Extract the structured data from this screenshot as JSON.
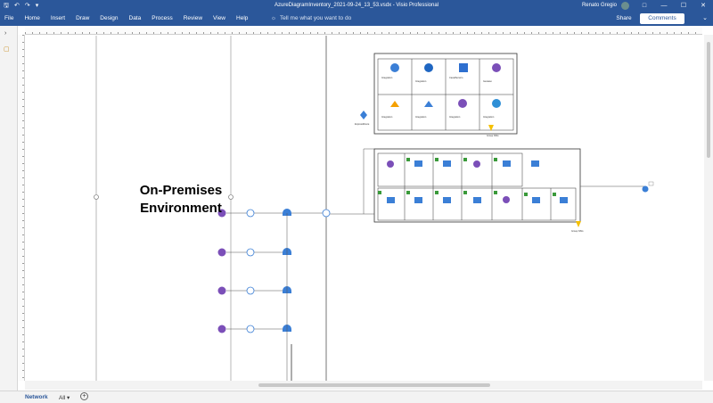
{
  "window": {
    "title": "AzureDiagramInventory_2021-09-24_13_53.vsdx  -  Visio Professional",
    "user": "Renato Gregio"
  },
  "ribbon": {
    "tabs": [
      "File",
      "Home",
      "Insert",
      "Draw",
      "Design",
      "Data",
      "Process",
      "Review",
      "View",
      "Help"
    ],
    "tell_me": "Tell me what you want to do",
    "share": "Share",
    "comments": "Comments"
  },
  "diagram": {
    "environment_label_line1": "On-Premises",
    "environment_label_line2": "Environment"
  },
  "page_tabs": {
    "active": "Network",
    "all": "All"
  },
  "colors": {
    "titlebar": "#2b579a",
    "accent": "#2b579a",
    "vpn_purple": "#7b4fb8",
    "connection_blue": "#3b7fd6",
    "warning_yellow": "#f5c000"
  }
}
